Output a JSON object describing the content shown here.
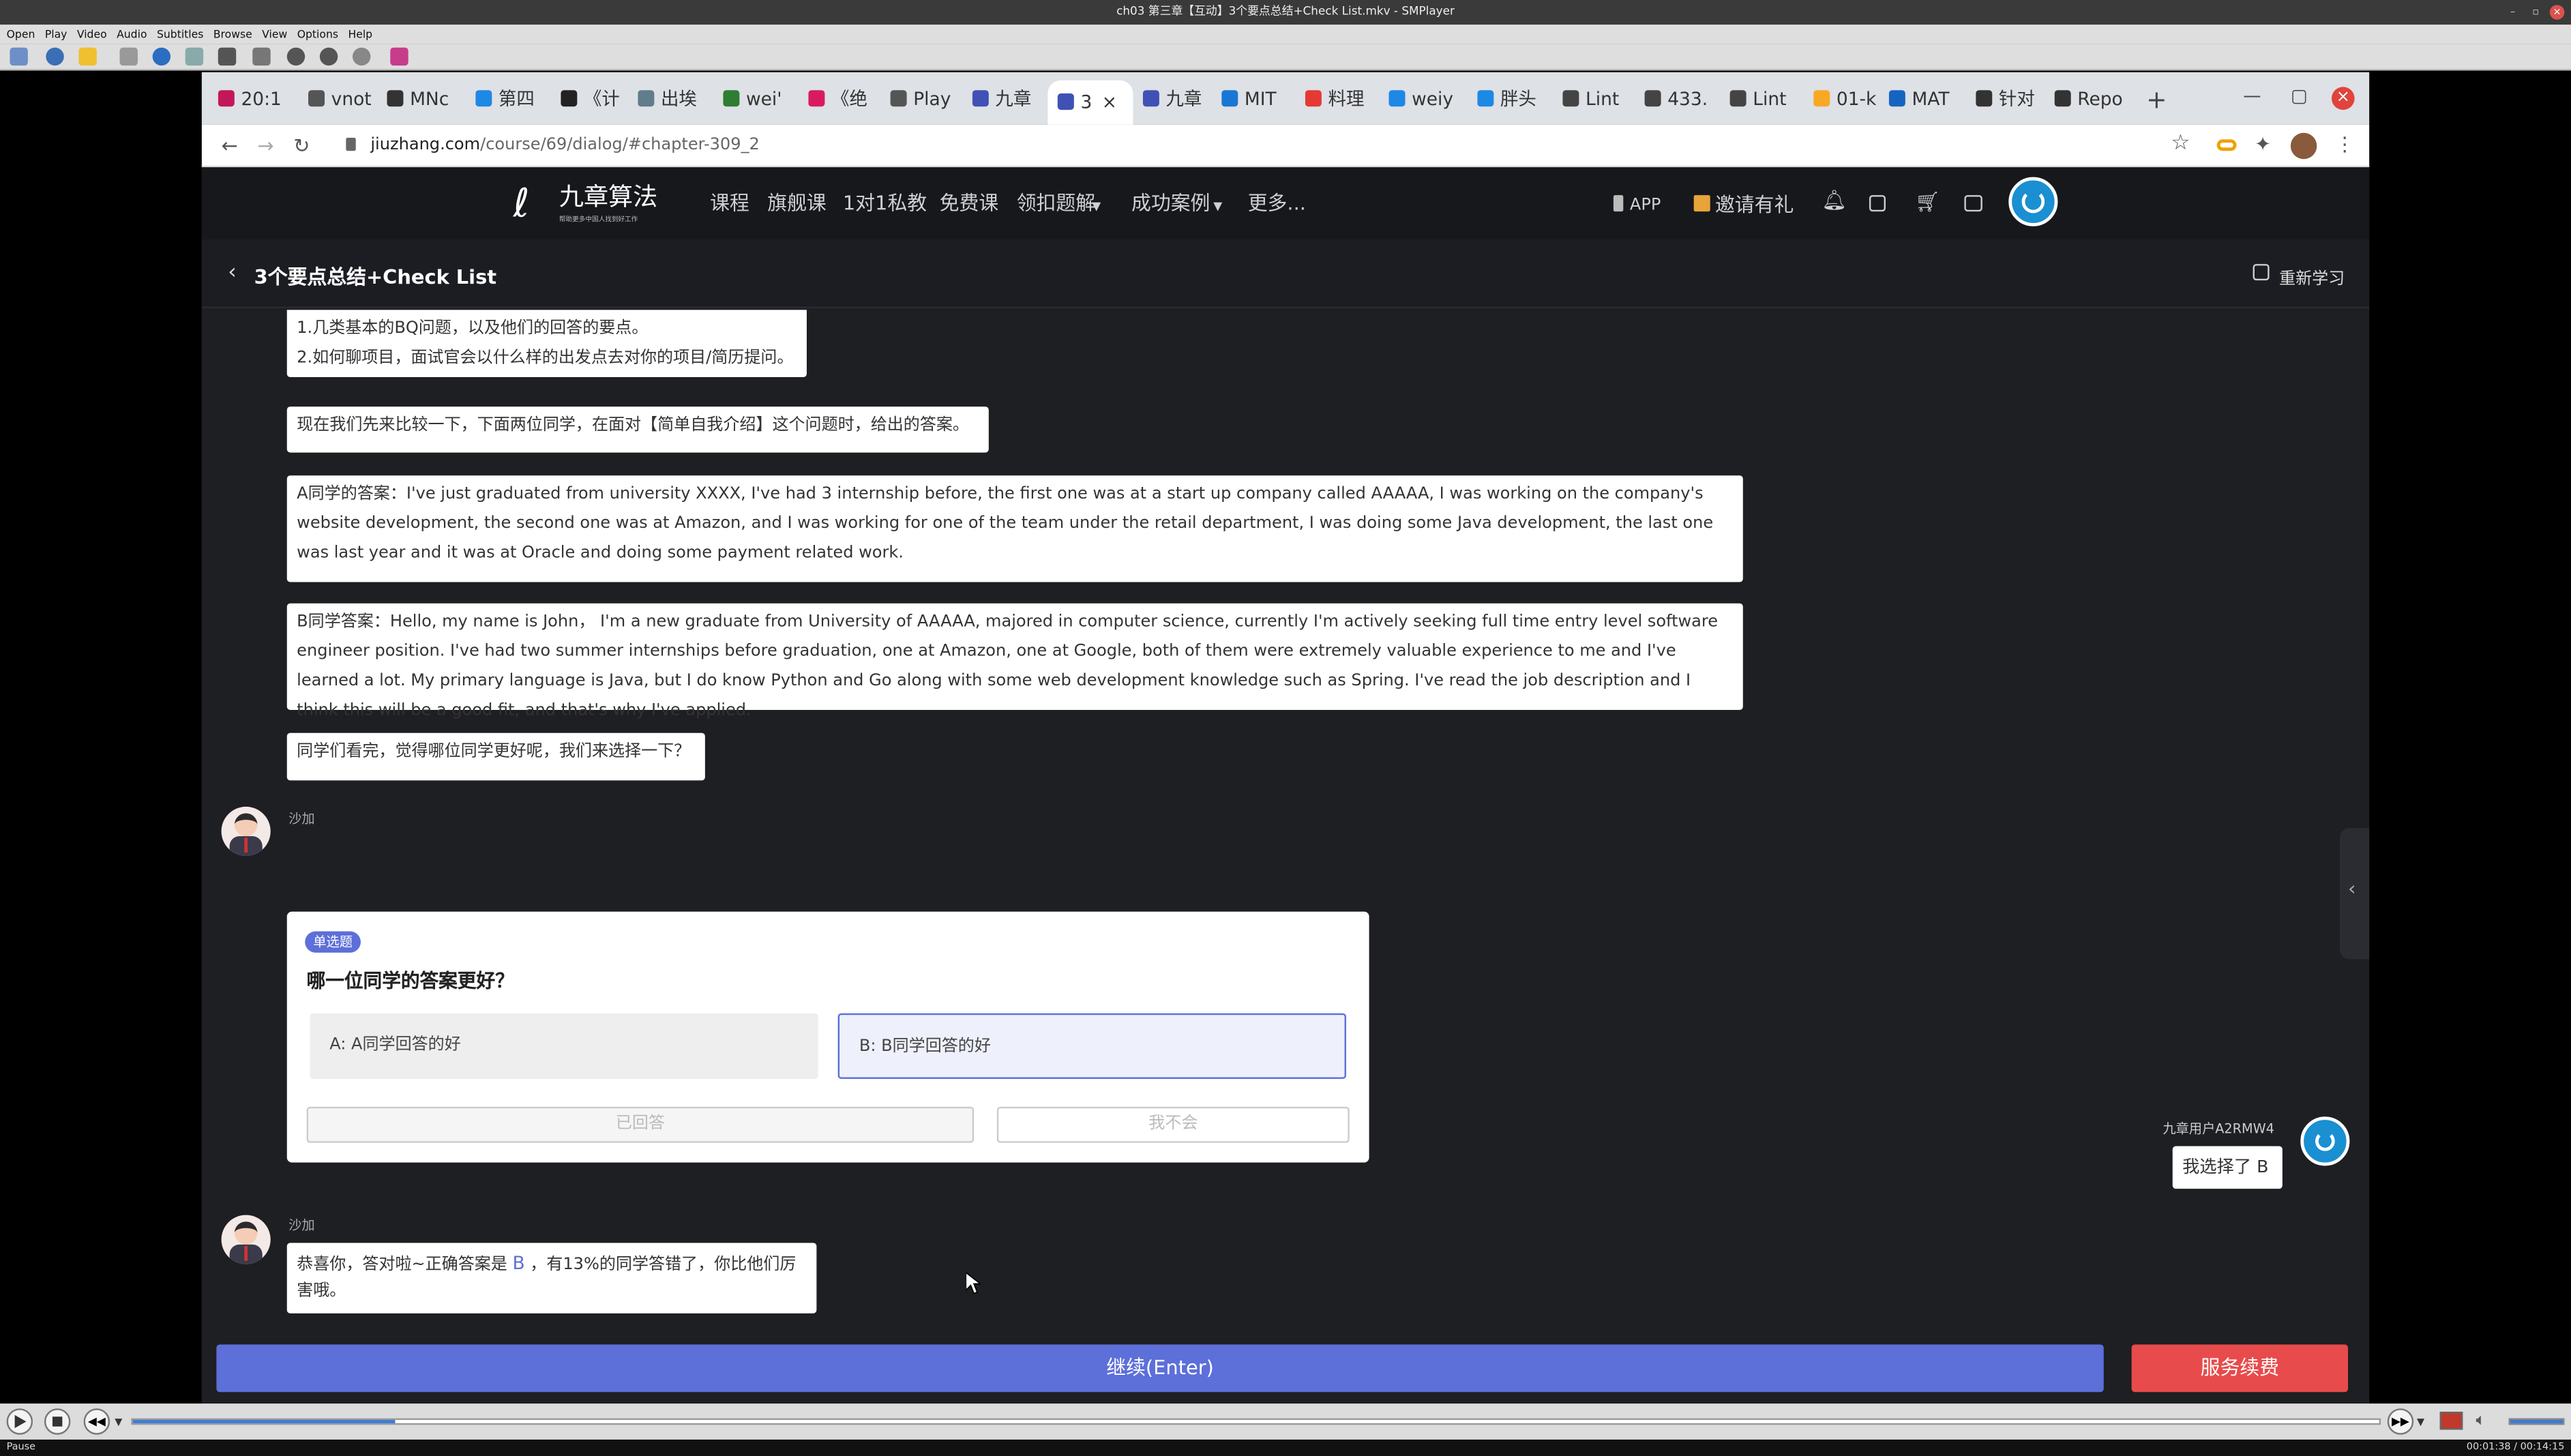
{
  "player": {
    "window_title": "ch03 第三章【互动】3个要点总结+Check List.mkv - SMPlayer",
    "menu": [
      "Open",
      "Play",
      "Video",
      "Audio",
      "Subtitles",
      "Browse",
      "View",
      "Options",
      "Help"
    ],
    "status_left": "Pause",
    "status_right": "00:01:38 / 00:14:15",
    "progress": 0.117
  },
  "browser": {
    "tabs": [
      {
        "label": "20:1",
        "icon_color": "#c2185b"
      },
      {
        "label": "vnot",
        "icon_color": "#555"
      },
      {
        "label": "MNc",
        "icon_color": "#333"
      },
      {
        "label": "第四",
        "icon_color": "#1e88e5"
      },
      {
        "label": "《计",
        "icon_color": "#222"
      },
      {
        "label": "出埃",
        "icon_color": "#607d8b"
      },
      {
        "label": "wei'",
        "icon_color": "#2e7d32"
      },
      {
        "label": "《绝",
        "icon_color": "#d81b60"
      },
      {
        "label": "Play",
        "icon_color": "#555"
      },
      {
        "label": "九章",
        "icon_color": "#3f51b5"
      },
      {
        "label": "3",
        "icon_color": "#3f51b5"
      },
      {
        "label": "九章",
        "icon_color": "#3f51b5"
      },
      {
        "label": "MIT",
        "icon_color": "#1976d2"
      },
      {
        "label": "料理",
        "icon_color": "#e53935"
      },
      {
        "label": "weiy",
        "icon_color": "#1e88e5"
      },
      {
        "label": "胖头",
        "icon_color": "#1e88e5"
      },
      {
        "label": "Lint",
        "icon_color": "#444"
      },
      {
        "label": "433.",
        "icon_color": "#444"
      },
      {
        "label": "Lint",
        "icon_color": "#444"
      },
      {
        "label": "01-k",
        "icon_color": "#f9a825"
      },
      {
        "label": "MAT",
        "icon_color": "#1565c0"
      },
      {
        "label": "针对",
        "icon_color": "#333"
      },
      {
        "label": "Repo",
        "icon_color": "#333"
      }
    ],
    "url_host": "jiuzhang.com",
    "url_path": "/course/69/dialog/#chapter-309_2"
  },
  "site": {
    "logo_text": "九章算法",
    "logo_sub": "帮助更多中国人找到好工作",
    "nav": [
      "课程",
      "旗舰课",
      "1对1私教",
      "免费课",
      "领扣题解",
      "成功案例",
      "更多..."
    ],
    "app_label": "APP",
    "invite_label": "邀请有礼",
    "page_title": "3个要点总结+Check List",
    "relearn_label": "重新学习"
  },
  "chat": {
    "m1_line1": "1.几类基本的BQ问题，以及他们的回答的要点。",
    "m1_line2": "2.如何聊项目，面试官会以什么样的出发点去对你的项目/简历提问。",
    "m2": "现在我们先来比较一下，下面两位同学，在面对【简单自我介绍】这个问题时，给出的答案。",
    "m3": "A同学的答案：I've just graduated from university XXXX, I've had 3 internship before, the first one was at a start up company called AAAAA, I was working on the company's website development, the second one was at Amazon, and I was working for one of the team under the retail department, I was doing some Java development, the last one was last year and it was at Oracle and doing some payment related work.",
    "m4": "B同学答案：Hello, my name is John， I'm a new graduate from University of AAAAA, majored in computer science, currently I'm actively seeking full time entry level software engineer position. I've had two summer internships before graduation, one at Amazon, one at Google, both of them were extremely valuable experience to me and I've learned a lot. My primary language is Java, but I do know Python and Go along with some web development knowledge such as Spring. I've read the job description and I think this will be a good fit, and that's why I've applied.",
    "m5": "同学们看完，觉得哪位同学更好呢，我们来选择一下？",
    "teacher_name": "沙加",
    "quiz_badge": "单选题",
    "quiz_question": "哪一位同学的答案更好？",
    "option_a": "A:  A同学回答的好",
    "option_b": "B:  B同学回答的好",
    "answered_label": "已回答",
    "dont_know_label": "我不会",
    "user_name": "九章用户A2RMW4",
    "user_reply": "我选择了 B",
    "feedback_pre": "恭喜你，答对啦~正确答案是 ",
    "feedback_answer": "B",
    "feedback_post": " ，有13%的同学答错了，你比他们厉害哦。",
    "continue_label": "继续(Enter)",
    "renew_label": "服务续费"
  },
  "colors": {
    "accent": "#5d6fd9",
    "danger": "#e84b4b",
    "badge": "#5d6fd9"
  }
}
